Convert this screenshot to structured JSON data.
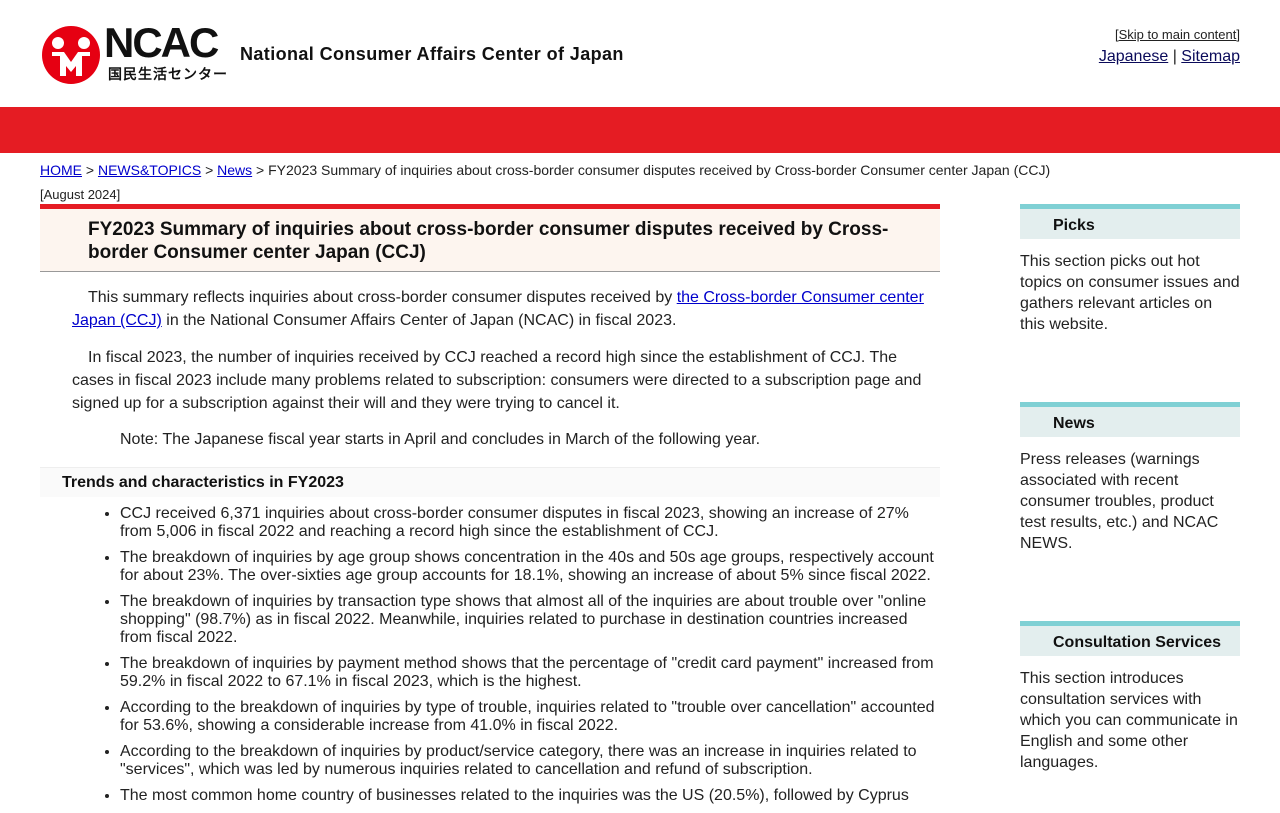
{
  "header": {
    "logo_text": "NCAC",
    "logo_sub": "国民生活センター",
    "org_name": "National Consumer Affairs Center of Japan",
    "skip_link": "Skip to main content",
    "lang_link": "Japanese",
    "sitemap_link": "Sitemap",
    "separator": "|"
  },
  "breadcrumb": {
    "items": [
      "HOME",
      "NEWS&TOPICS",
      "News"
    ],
    "separator": ">",
    "current": "FY2023 Summary of inquiries about cross-border consumer disputes received by Cross-border Consumer center Japan (CCJ)"
  },
  "article": {
    "date": "[August 2024]",
    "title": "FY2023 Summary of inquiries about cross-border consumer disputes received by Cross-border Consumer center Japan (CCJ)",
    "p1_before": "This summary reflects inquiries about cross-border consumer disputes received by ",
    "p1_link": "the Cross-border Consumer center Japan (CCJ)",
    "p1_after": " in the National Consumer Affairs Center of Japan (NCAC) in fiscal 2023.",
    "p2": "In fiscal 2023, the number of inquiries received by CCJ reached a record high since the establishment of CCJ. The cases in fiscal 2023 include many problems related to subscription: consumers were directed to a subscription page and signed up for a subscription against their will and they were trying to cancel it.",
    "note": "Note: The Japanese fiscal year starts in April and concludes in March of the following year.",
    "section_title": "Trends and characteristics in FY2023",
    "bullets": [
      "CCJ received 6,371 inquiries about cross-border consumer disputes in fiscal 2023, showing an increase of 27% from 5,006 in fiscal 2022 and reaching a record high since the establishment of CCJ.",
      "The breakdown of inquiries by age group shows concentration in the 40s and 50s age groups, respectively account for about 23%. The over-sixties age group accounts for 18.1%, showing an increase of about 5% since fiscal 2022.",
      "The breakdown of inquiries by transaction type shows that almost all of the inquiries are about trouble over \"online shopping\" (98.7%) as in fiscal 2022. Meanwhile, inquiries related to purchase in destination countries increased from fiscal 2022.",
      "The breakdown of inquiries by payment method shows that the percentage of \"credit card payment\" increased from 59.2% in fiscal 2022 to 67.1% in fiscal 2023, which is the highest.",
      "According to the breakdown of inquiries by type of trouble, inquiries related to \"trouble over cancellation\" accounted for 53.6%, showing a considerable increase from 41.0% in fiscal 2022.",
      "According to the breakdown of inquiries by product/service category, there was an increase in inquiries related to \"services\", which was led by numerous inquiries related to cancellation and refund of subscription.",
      "The most common home country of businesses related to the inquiries was the US (20.5%), followed by Cyprus"
    ]
  },
  "sidebar": {
    "blocks": [
      {
        "title": "Picks",
        "text": "This section picks out hot topics on consumer issues and gathers relevant articles on this website."
      },
      {
        "title": "News",
        "text": "Press releases (warnings associated with recent consumer troubles, product test results, etc.) and NCAC NEWS."
      },
      {
        "title": "Consultation Services",
        "text": "This section introduces consultation services with which you can communicate in English and some other languages."
      }
    ]
  },
  "colors": {
    "brand_red": "#e51c23",
    "sidebar_accent": "#7fd0d4",
    "link": "#0000cc"
  }
}
